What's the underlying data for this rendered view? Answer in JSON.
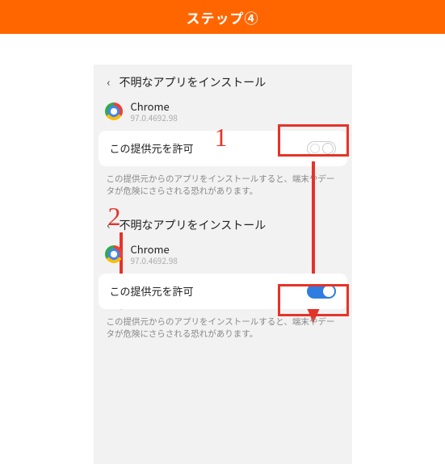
{
  "header": {
    "title": "ステップ④"
  },
  "panel": {
    "screen_title": "不明なアプリをインストール",
    "app_name": "Chrome",
    "app_version": "97.0.4692.98",
    "toggle_label": "この提供元を許可",
    "warning": "この提供元からのアプリをインストールすると、端末やデータが危険にさらされる恐れがあります。"
  },
  "annotations": {
    "num1": "1",
    "num2": "2"
  },
  "colors": {
    "accent_orange": "#ff6600",
    "annotation_red": "#E53329",
    "toggle_on_blue": "#2f7de1"
  }
}
